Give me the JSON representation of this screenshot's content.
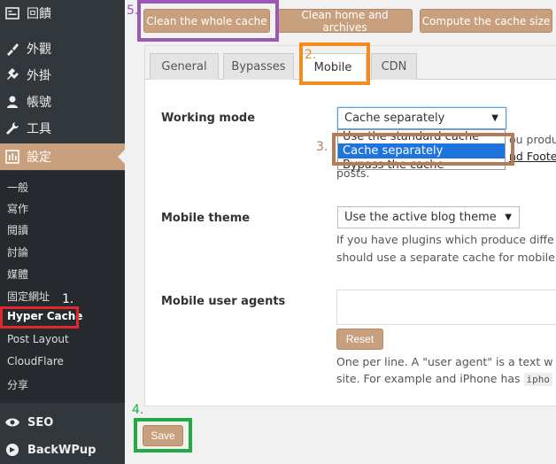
{
  "sidebar": {
    "top_items": [
      {
        "label": "回饋",
        "icon": "feedback-icon"
      },
      {
        "label": "外觀",
        "icon": "appearance-icon"
      },
      {
        "label": "外掛",
        "icon": "plugins-icon"
      },
      {
        "label": "帳號",
        "icon": "user-icon"
      },
      {
        "label": "工具",
        "icon": "wrench-icon"
      },
      {
        "label": "設定",
        "icon": "settings-icon"
      }
    ],
    "sub_items": [
      "一般",
      "寫作",
      "閱讀",
      "討論",
      "媒體",
      "固定網址",
      "Hyper Cache",
      "Post Layout",
      "CloudFlare",
      "分享"
    ],
    "bottom_items": [
      {
        "label": "SEO",
        "icon": "seo-icon"
      },
      {
        "label": "BackWPup",
        "icon": "backwpup-icon"
      }
    ]
  },
  "actions": {
    "clean_all": "Clean the whole cache",
    "clean_home": "Clean home and archives",
    "compute_size": "Compute the cache size"
  },
  "tabs": [
    "General",
    "Bypasses",
    "Mobile",
    "CDN"
  ],
  "settings": {
    "working_mode": {
      "label": "Working mode",
      "value": "Cache separately",
      "options": [
        "Use the standard cache",
        "Cache separately",
        "Bypass the cache"
      ],
      "desc_line1": "ou produ",
      "desc_line2_link": "nd Footer",
      "desc_line3": "posts."
    },
    "mobile_theme": {
      "label": "Mobile theme",
      "value": "Use the active blog theme",
      "desc_line1": "If you have plugins which produce diffe",
      "desc_line2": "should use a separate cache for mobile"
    },
    "mobile_user_agents": {
      "label": "Mobile user agents",
      "reset_label": "Reset",
      "desc_line1": "One per line. A \"user agent\" is a text w",
      "desc_line2": "site. For example and iPhone has",
      "desc_code": "ipho"
    }
  },
  "save_label": "Save",
  "annotations": {
    "n1": "1.",
    "n2": "2.",
    "n3": "3.",
    "n4": "4.",
    "n5": "5."
  },
  "colors": {
    "sidebar_bg": "#32373c",
    "accent": "#c8a07e",
    "annot_red": "#e0282e",
    "annot_orange": "#f58a1f",
    "annot_brown": "#b07c5a",
    "annot_green": "#22aa44",
    "annot_purple": "#9b59b6"
  }
}
